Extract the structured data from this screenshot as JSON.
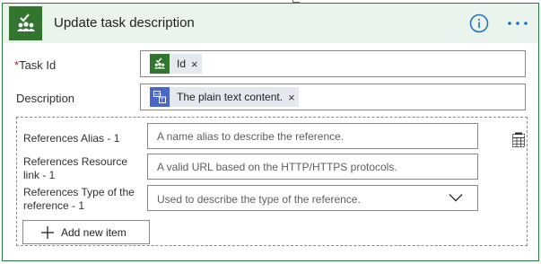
{
  "header": {
    "title": "Update task description",
    "info_icon": "info-icon",
    "more_icon": "more-options-icon",
    "app_icon": "planner-icon",
    "accent_color": "#31752f"
  },
  "fields": {
    "task_id": {
      "required_marker": "*",
      "label": "Task Id",
      "token": {
        "label": "Id",
        "remove": "×",
        "icon": "planner-icon"
      }
    },
    "description": {
      "label": "Description",
      "token": {
        "label": "The plain text content.",
        "remove": "×",
        "icon": "html-to-text-icon"
      }
    }
  },
  "references": {
    "alias": {
      "label": "References Alias - 1",
      "placeholder": "A name alias to describe the reference."
    },
    "resource_link": {
      "label_line1": "References Resource",
      "label_line2": "link - 1",
      "placeholder": "A valid URL based on the HTTP/HTTPS protocols."
    },
    "type": {
      "label_line1": "References Type of the",
      "label_line2": "reference - 1",
      "placeholder": "Used to describe the type of the reference."
    },
    "add_button_label": "Add new item",
    "table_icon": "table-icon"
  }
}
